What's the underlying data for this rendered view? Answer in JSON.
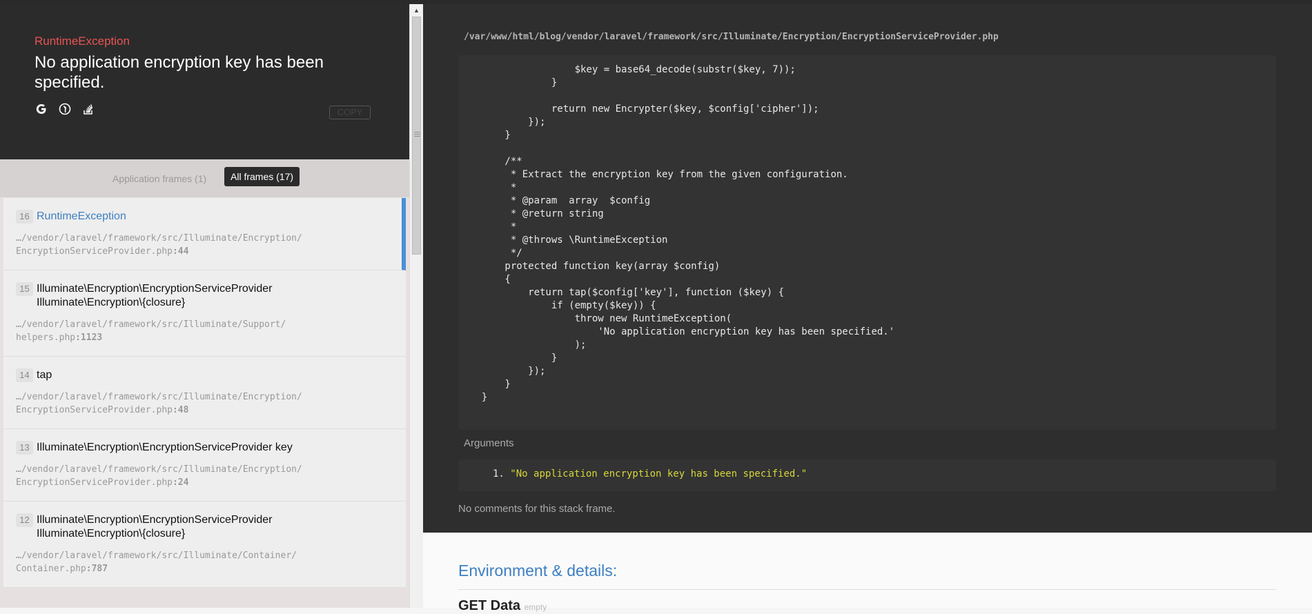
{
  "exception": {
    "class": "RuntimeException",
    "message": "No application encryption key has been specified.",
    "icons": [
      "google-icon",
      "duckduckgo-icon",
      "stackoverflow-icon"
    ],
    "copy_label": "COPY"
  },
  "frames_toggle": {
    "application_label": "Application frames (1)",
    "all_label": "All frames (17)"
  },
  "frames": [
    {
      "num": "16",
      "class": "RuntimeException",
      "file1": "…/vendor/laravel/framework/src/Illuminate/Encryption/",
      "file2": "EncryptionServiceProvider.php",
      "line": ":44"
    },
    {
      "num": "15",
      "class": "Illuminate\\Encryption\\EncryptionServiceProvider Illuminate\\Encryption\\{closure}",
      "file1": "…/vendor/laravel/framework/src/Illuminate/Support/",
      "file2": "helpers.php",
      "line": ":1123"
    },
    {
      "num": "14",
      "class": "tap",
      "file1": "…/vendor/laravel/framework/src/Illuminate/Encryption/",
      "file2": "EncryptionServiceProvider.php",
      "line": ":48"
    },
    {
      "num": "13",
      "class": "Illuminate\\Encryption\\EncryptionServiceProvider key",
      "file1": "…/vendor/laravel/framework/src/Illuminate/Encryption/",
      "file2": "EncryptionServiceProvider.php",
      "line": ":24"
    },
    {
      "num": "12",
      "class": "Illuminate\\Encryption\\EncryptionServiceProvider Illuminate\\Encryption\\{closure}",
      "file1": "…/vendor/laravel/framework/src/Illuminate/Container/",
      "file2": "Container.php",
      "line": ":787"
    }
  ],
  "code": {
    "file_path": "/var/www/html/blog/vendor/laravel/framework/src/Illuminate/Encryption/EncryptionServiceProvider.php",
    "lines": [
      "                    $key = base64_decode(substr($key, 7));",
      "                }",
      "",
      "                return new Encrypter($key, $config['cipher']);",
      "            });",
      "        }",
      "",
      "        /**",
      "         * Extract the encryption key from the given configuration.",
      "         *",
      "         * @param  array  $config",
      "         * @return string",
      "         *",
      "         * @throws \\RuntimeException",
      "         */",
      "        protected function key(array $config)",
      "        {",
      "            return tap($config['key'], function ($key) {",
      "                if (empty($key)) {",
      "                    throw new RuntimeException(",
      "                        'No application encryption key has been specified.'",
      "                    );",
      "                }",
      "            });",
      "        }",
      "    }"
    ]
  },
  "arguments": {
    "title": "Arguments",
    "index": "1.",
    "value": "\"No application encryption key has been specified.\""
  },
  "no_comments": "No comments for this stack frame.",
  "environment": {
    "title": "Environment & details:",
    "get_title": "GET Data",
    "get_empty": "empty"
  }
}
